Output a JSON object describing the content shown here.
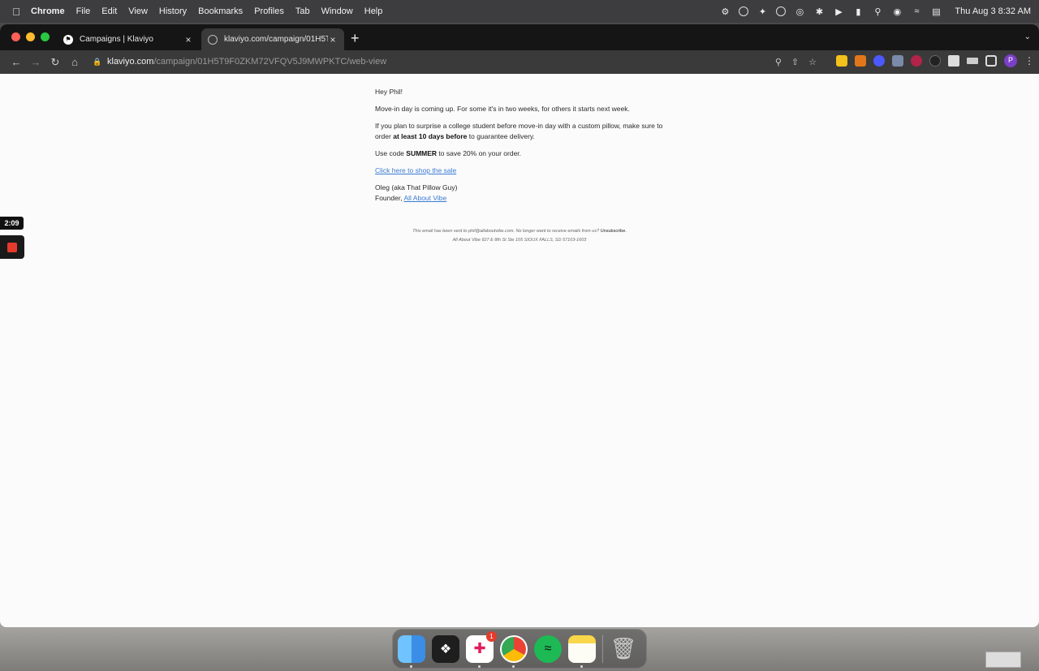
{
  "menubar": {
    "app_name": "Chrome",
    "items": [
      "File",
      "Edit",
      "View",
      "History",
      "Bookmarks",
      "Profiles",
      "Tab",
      "Window",
      "Help"
    ],
    "clock": "Thu Aug 3  8:32 AM"
  },
  "tabs": [
    {
      "title": "Campaigns | Klaviyo",
      "active": false
    },
    {
      "title": "klaviyo.com/campaign/01H5T9",
      "active": true
    }
  ],
  "address_bar": {
    "host": "klaviyo.com",
    "path": "/campaign/01H5T9F0ZKM72VFQV5J9MWPKTC/web-view"
  },
  "profile_initial": "P",
  "email": {
    "greeting": "Hey Phil!",
    "p1": "Move-in day is coming up. For some it's in two weeks, for others it starts next week.",
    "p2_start": "If you plan to surprise a college student before move-in day with a custom pillow, make sure to order ",
    "p2_bold": "at least 10 days before",
    "p2_end": " to guarantee delivery.",
    "p3_start": "Use code ",
    "p3_bold": "SUMMER",
    "p3_end": " to save 20% on your order.",
    "cta_link": "Click here to shop the sale",
    "signature_name": "Oleg (aka That Pillow Guy)",
    "signature_role": "Founder, ",
    "signature_link": "All About Vibe"
  },
  "footer": {
    "line1": "This email has been sent to phil@allaboutvibe.com. No longer want to receive emails from us? ",
    "unsubscribe": "Unsubscribe.",
    "line2": "All About Vibe 927 E 8th St Ste 105 SIOUX FALLS, SD 57103-1603"
  },
  "recording": {
    "timer": "2:09"
  },
  "dock": {
    "slack_badge": "1"
  }
}
